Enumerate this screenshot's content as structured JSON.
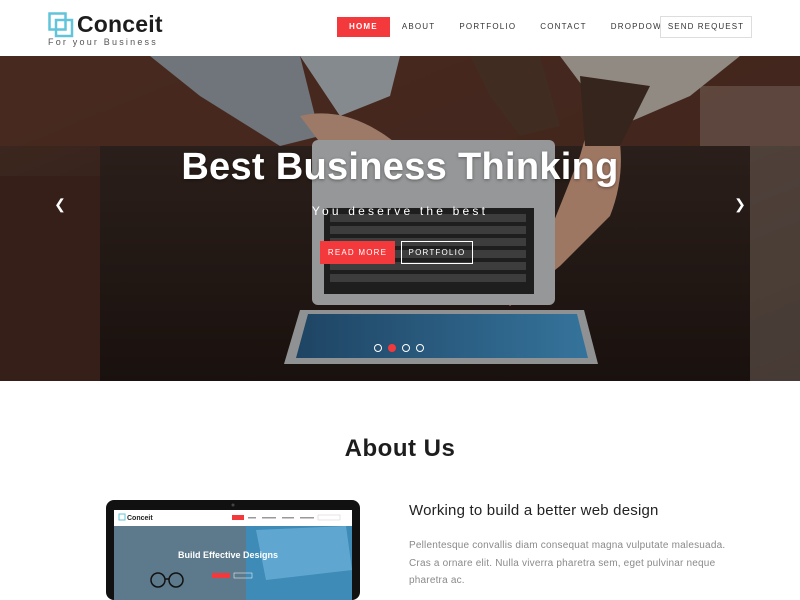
{
  "brand": {
    "name": "Conceit",
    "tagline": "For your Business",
    "accent_color": "#f4393c",
    "logo_color": "#62c4da"
  },
  "nav": {
    "items": [
      {
        "label": "HOME",
        "active": true
      },
      {
        "label": "ABOUT",
        "active": false
      },
      {
        "label": "PORTFOLIO",
        "active": false
      },
      {
        "label": "CONTACT",
        "active": false
      },
      {
        "label": "DROPDOWN",
        "active": false
      }
    ],
    "cta_label": "SEND REQUEST"
  },
  "hero": {
    "title": "Best Business Thinking",
    "subtitle": "You deserve the best",
    "primary_button": "READ MORE",
    "secondary_button": "PORTFOLIO",
    "prev_icon": "chevron-left-icon",
    "next_icon": "chevron-right-icon",
    "slide_count": 4,
    "active_slide": 2
  },
  "about": {
    "title": "About Us",
    "heading": "Working to build a better web design",
    "text": "Pellentesque convallis diam consequat magna vulputate malesuada. Cras a ornare elit. Nulla viverra pharetra sem, eget pulvinar neque pharetra ac.",
    "laptop_screen": {
      "brand": "Conceit",
      "headline": "Build Effective Designs"
    }
  }
}
